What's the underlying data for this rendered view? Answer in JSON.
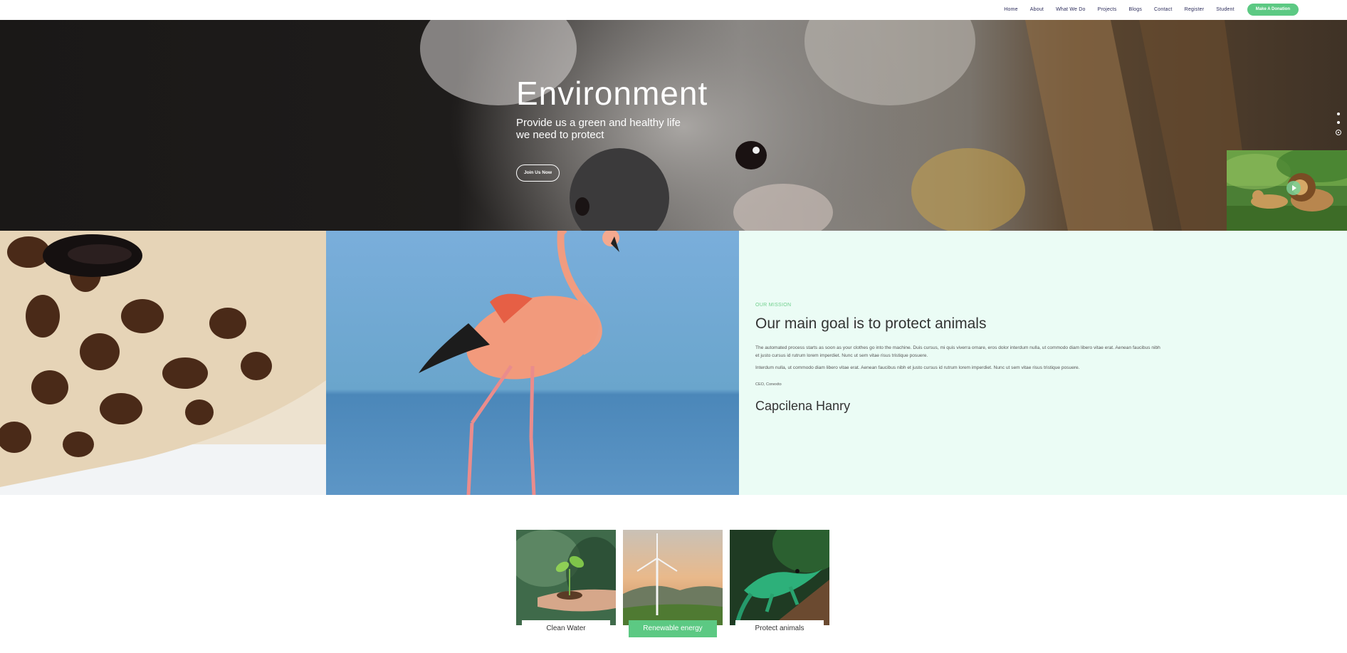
{
  "nav": {
    "items": [
      "Home",
      "About",
      "What We Do",
      "Projects",
      "Blogs",
      "Contact",
      "Register",
      "Student"
    ],
    "donate_label": "Make A Donation"
  },
  "hero": {
    "title": "Environment",
    "subtitle_line1": "Provide us a green and healthy life",
    "subtitle_line2": "we need to protect",
    "cta_label": "Join Us Now",
    "slide_indicators": 3,
    "active_slide": 3
  },
  "mission": {
    "eyebrow": "OUR MISSION",
    "title": "Our main goal is to protect animals",
    "paragraph1": "The automated process starts as soon as your clothes go into the machine. Duis cursus, mi quis viverra ornare, eros dolor interdum nulla, ut commodo diam libero vitae erat. Aenean faucibus nibh et justo cursus id rutrum lorem imperdiet. Nunc ut sem vitae risus tristique posuere.",
    "paragraph2": "Interdum nulla, ut commodo diam libero vitae erat. Aenean faucibus nibh et justo cursus id rutrum lorem imperdiet. Nunc ut sem vitae risus tristique posuere.",
    "role": "CEO, Conexito",
    "name": "Capcilena Hanry"
  },
  "cards": [
    {
      "label": "Clean Water",
      "icon": "seedling-in-hand-image",
      "active": false
    },
    {
      "label": "Renewable energy",
      "icon": "wind-turbine-image",
      "active": true
    },
    {
      "label": "Protect animals",
      "icon": "lizard-image",
      "active": false
    }
  ],
  "colors": {
    "accent": "#5cc983",
    "mission_bg": "#ebfcf5",
    "nav_text": "#2b2b5a"
  }
}
